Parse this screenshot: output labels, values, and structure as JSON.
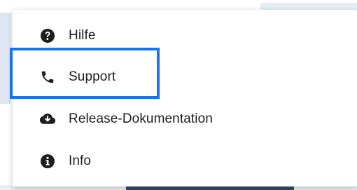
{
  "menu": {
    "items": [
      {
        "label": "Hilfe",
        "icon": "question-circle-icon"
      },
      {
        "label": "Support",
        "icon": "phone-icon"
      },
      {
        "label": "Release-Dokumentation",
        "icon": "cloud-download-icon"
      },
      {
        "label": "Info",
        "icon": "info-circle-icon"
      }
    ],
    "focused_item": "Support"
  },
  "colors": {
    "focus_ring": "#1a73e8",
    "icon": "#1e1e1e",
    "text": "#1e1e1e"
  }
}
